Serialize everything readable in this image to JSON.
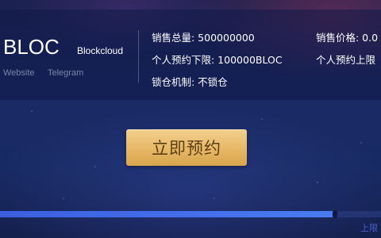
{
  "token": {
    "symbol": "BLOC",
    "full_name": "Blockcloud",
    "links": [
      "Website",
      "Telegram"
    ]
  },
  "stats": {
    "total_supply": "销售总量: 500000000",
    "price": "销售价格: 0.0",
    "min_presale": "个人预约下限: 100000BLOC",
    "max_presale": "个人预约上限",
    "lock": "锁仓机制: 不锁仓"
  },
  "action": {
    "presale_label": "立即预约"
  },
  "progress": {
    "fraction": 0.88,
    "cap_label": "上限"
  },
  "colors": {
    "accent_gold": "#e7b765",
    "progress_blue": "#4a7bf2",
    "background_navy": "#1a2a66"
  }
}
